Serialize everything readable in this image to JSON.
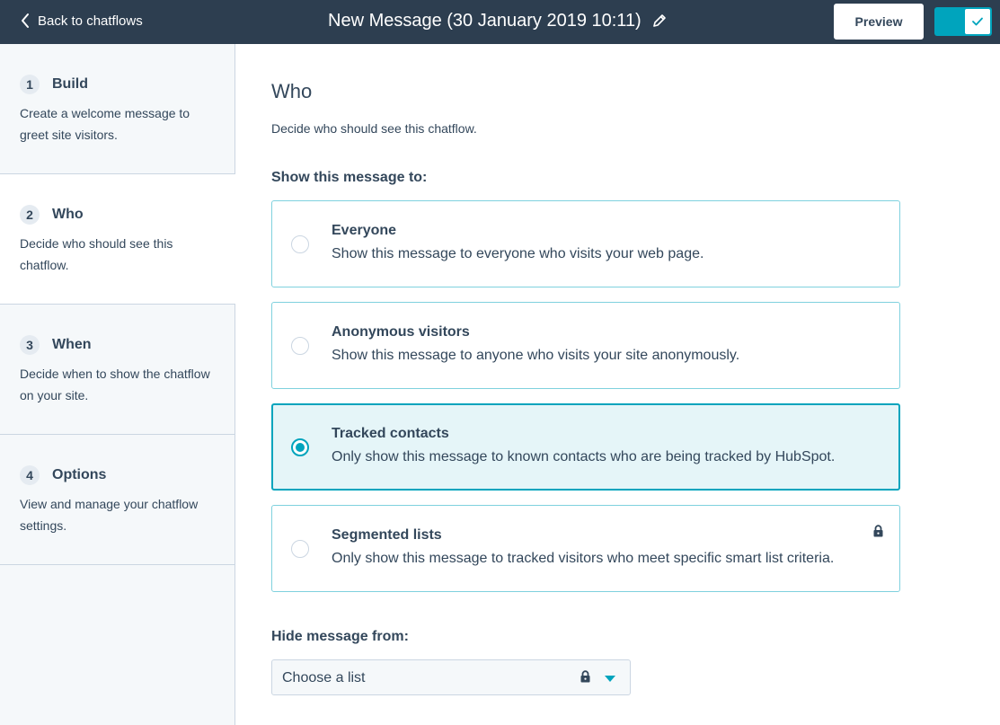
{
  "header": {
    "back_label": "Back to chatflows",
    "title": "New Message (30 January 2019 10:11)",
    "preview_label": "Preview",
    "toggle_on": true
  },
  "sidebar": {
    "steps": [
      {
        "number": "1",
        "title": "Build",
        "description": "Create a welcome message to greet site visitors.",
        "active": false
      },
      {
        "number": "2",
        "title": "Who",
        "description": "Decide who should see this chatflow.",
        "active": true
      },
      {
        "number": "3",
        "title": "When",
        "description": "Decide when to show the chatflow on your site.",
        "active": false
      },
      {
        "number": "4",
        "title": "Options",
        "description": "View and manage your chatflow settings.",
        "active": false
      }
    ]
  },
  "main": {
    "title": "Who",
    "description": "Decide who should see this chatflow.",
    "show_label": "Show this message to:",
    "options": [
      {
        "title": "Everyone",
        "description": "Show this message to everyone who visits your web page.",
        "selected": false,
        "locked": false
      },
      {
        "title": "Anonymous visitors",
        "description": "Show this message to anyone who visits your site anonymously.",
        "selected": false,
        "locked": false
      },
      {
        "title": "Tracked contacts",
        "description": "Only show this message to known contacts who are being tracked by HubSpot.",
        "selected": true,
        "locked": false
      },
      {
        "title": "Segmented lists",
        "description": "Only show this message to tracked visitors who meet specific smart list criteria.",
        "selected": false,
        "locked": true
      }
    ],
    "hide_label": "Hide message from:",
    "hide_select": {
      "value": "Choose a list",
      "locked": true
    }
  },
  "colors": {
    "topbar": "#2d3e50",
    "accent": "#00a4bd",
    "text": "#33475b",
    "sidebar_bg": "#f5f8fa",
    "selected_bg": "#e5f5f8"
  }
}
